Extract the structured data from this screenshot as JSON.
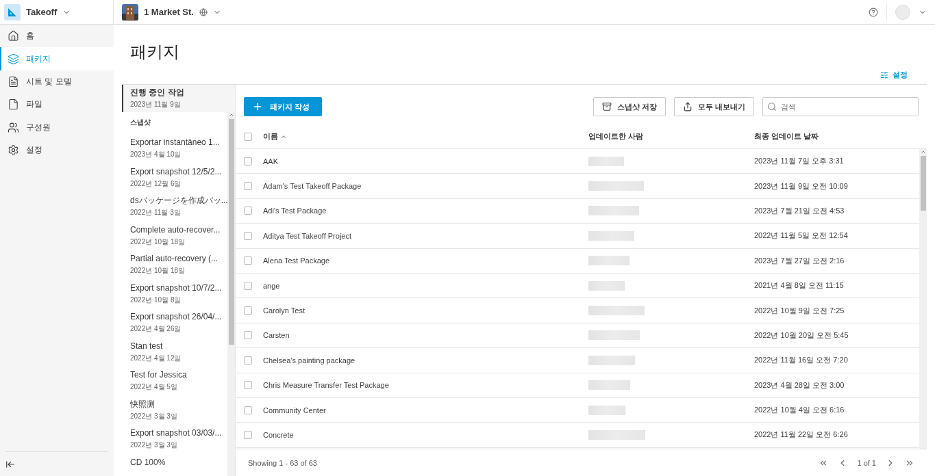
{
  "topbar": {
    "app": "Takeoff",
    "project": "1 Market St."
  },
  "sidebar": {
    "items": [
      {
        "label": "홈",
        "selected": false
      },
      {
        "label": "패키지",
        "selected": true
      },
      {
        "label": "시트 및 모델",
        "selected": false
      },
      {
        "label": "파일",
        "selected": false
      },
      {
        "label": "구성원",
        "selected": false
      },
      {
        "label": "설정",
        "selected": false
      }
    ]
  },
  "page": {
    "title": "패키지",
    "settings_link": "설정"
  },
  "snapshots": {
    "current": {
      "title": "진행 중인 작업",
      "date": "2023년 11월 9일",
      "selected": true
    },
    "heading": "스냅샷",
    "items": [
      {
        "title": "Exportar instantâneo 1...",
        "date": "2023년 4월 10일"
      },
      {
        "title": "Export snapshot 12/5/2...",
        "date": "2022년 12월 6일"
      },
      {
        "title": "dsパッケージを作成パッ...",
        "date": "2022년 11월 3일"
      },
      {
        "title": "Complete auto-recover...",
        "date": "2022년 10월 18일"
      },
      {
        "title": "Partial auto-recovery (...",
        "date": "2022년 10월 18일"
      },
      {
        "title": "Export snapshot 10/7/2...",
        "date": "2022년 10월 8일"
      },
      {
        "title": "Export snapshot 26/04/...",
        "date": "2022년 4월 26일"
      },
      {
        "title": "Stan test",
        "date": "2022년 4월 12일"
      },
      {
        "title": "Test for Jessica",
        "date": "2022년 4월 5일"
      },
      {
        "title": "快照测",
        "date": "2022년 3월 3일"
      },
      {
        "title": "Export snapshot 03/03/...",
        "date": "2022년 3월 3일"
      },
      {
        "title": "CD 100%"
      }
    ]
  },
  "toolbar": {
    "create_button": "패키지 작성",
    "save_snapshot_button": "스냅샷 저장",
    "export_all_button": "모두 내보내기",
    "search": {
      "placeholder": "검색"
    }
  },
  "table": {
    "all_checked": false,
    "columns": [
      "이름",
      "업데이트한 사람",
      "최종 업데이트 날짜"
    ],
    "rows": [
      {
        "name": "AAK",
        "updated": "2023년 11월 7일 오후 3:31",
        "checked": false
      },
      {
        "name": "Adam's Test Takeoff Package",
        "updated": "2023년 11월 9일 오전 10:09",
        "checked": false
      },
      {
        "name": "Adi's Test Package",
        "updated": "2023년 7월 21일 오전 4:53",
        "checked": false
      },
      {
        "name": "Aditya Test Takeoff Project",
        "updated": "2022년 11월 5일 오전 12:54",
        "checked": false
      },
      {
        "name": "Alena Test Package",
        "updated": "2023년 7월 27일 오전 2:16",
        "checked": false
      },
      {
        "name": "ange",
        "updated": "2021년 4월 8일 오전 11:15",
        "checked": false
      },
      {
        "name": "Carolyn Test",
        "updated": "2022년 10월 9일 오전 7:25",
        "checked": false
      },
      {
        "name": "Carsten",
        "updated": "2022년 10월 20일 오전 5:45",
        "checked": false
      },
      {
        "name": "Chelsea's painting package",
        "updated": "2022년 11월 16일 오전 7:20",
        "checked": false
      },
      {
        "name": "Chris Measure Transfer Test Package",
        "updated": "2023년 4월 28일 오전 3:00",
        "checked": false
      },
      {
        "name": "Community Center",
        "updated": "2022년 10월 4일 오전 6:16",
        "checked": false
      },
      {
        "name": "Concrete",
        "updated": "2022년 11월 22일 오전 6:26",
        "checked": false
      }
    ]
  },
  "footer": {
    "showing": "Showing 1 - 63 of 63",
    "page": "1 of 1"
  }
}
